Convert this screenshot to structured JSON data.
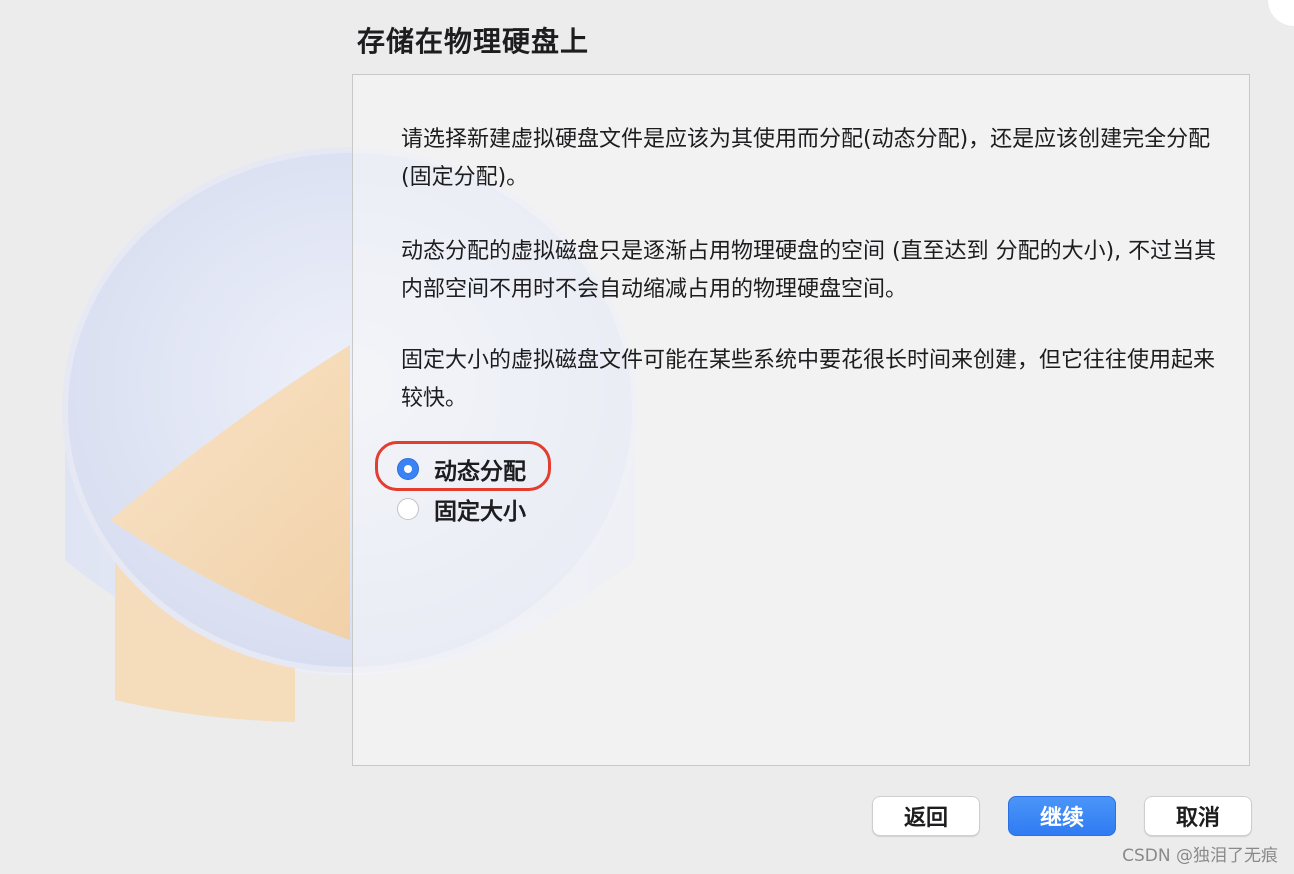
{
  "window": {
    "title": "存储在物理硬盘上"
  },
  "panel": {
    "paragraphs": [
      "请选择新建虚拟硬盘文件是应该为其使用而分配(动态分配)，还是应该创建完全分配(固定分配)。",
      "动态分配的虚拟磁盘只是逐渐占用物理硬盘的空间 (直至达到 分配的大小), 不过当其内部空间不用时不会自动缩减占用的物理硬盘空间。",
      "固定大小的虚拟磁盘文件可能在某些系统中要花很长时间来创建，但它往往使用起来较快。"
    ],
    "options": [
      {
        "label": "动态分配",
        "selected": true
      },
      {
        "label": "固定大小",
        "selected": false
      }
    ]
  },
  "buttons": {
    "back": "返回",
    "continue": "继续",
    "cancel": "取消"
  },
  "watermark": "CSDN @独泪了无痕",
  "colors": {
    "accent": "#3b82f6",
    "highlight_ring": "#e23d2f"
  }
}
